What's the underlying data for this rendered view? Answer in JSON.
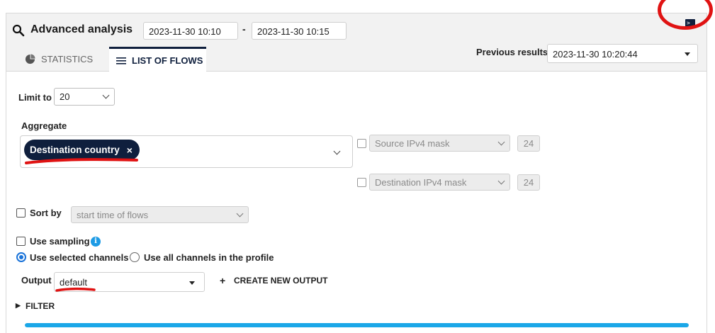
{
  "header": {
    "title": "Advanced analysis",
    "date_from": "2023-11-30 10:10",
    "date_separator": "-",
    "date_to": "2023-11-30 10:15"
  },
  "tabs": [
    {
      "label": "STATISTICS",
      "icon": "pie-chart-icon",
      "active": false
    },
    {
      "label": "LIST OF FLOWS",
      "icon": "list-icon",
      "active": true
    }
  ],
  "previous_results": {
    "label": "Previous results",
    "value": "2023-11-30 10:20:44"
  },
  "form": {
    "limit_label": "Limit to",
    "limit_value": "20",
    "aggregate_label": "Aggregate",
    "aggregate_chip": "Destination country",
    "chip_close": "×",
    "source_mask_placeholder": "Source IPv4 mask",
    "source_mask_value": "24",
    "dest_mask_placeholder": "Destination IPv4 mask",
    "dest_mask_value": "24",
    "sort_label": "Sort by",
    "sort_value": "start time of flows",
    "sampling_label": "Use sampling",
    "info_glyph": "i",
    "channels_selected_label": "Use selected channels",
    "channels_all_label": "Use all channels in the profile",
    "output_label": "Output",
    "output_value": "default",
    "create_output_plus": "+",
    "create_output_label": "CREATE NEW OUTPUT",
    "filter_label": "FILTER",
    "filter_arrow": "▶"
  },
  "progress": {
    "percent": 100
  },
  "colors": {
    "navy": "#0f1f3d",
    "accent_blue": "#1aa7e8",
    "annotation_red": "#e01313"
  }
}
